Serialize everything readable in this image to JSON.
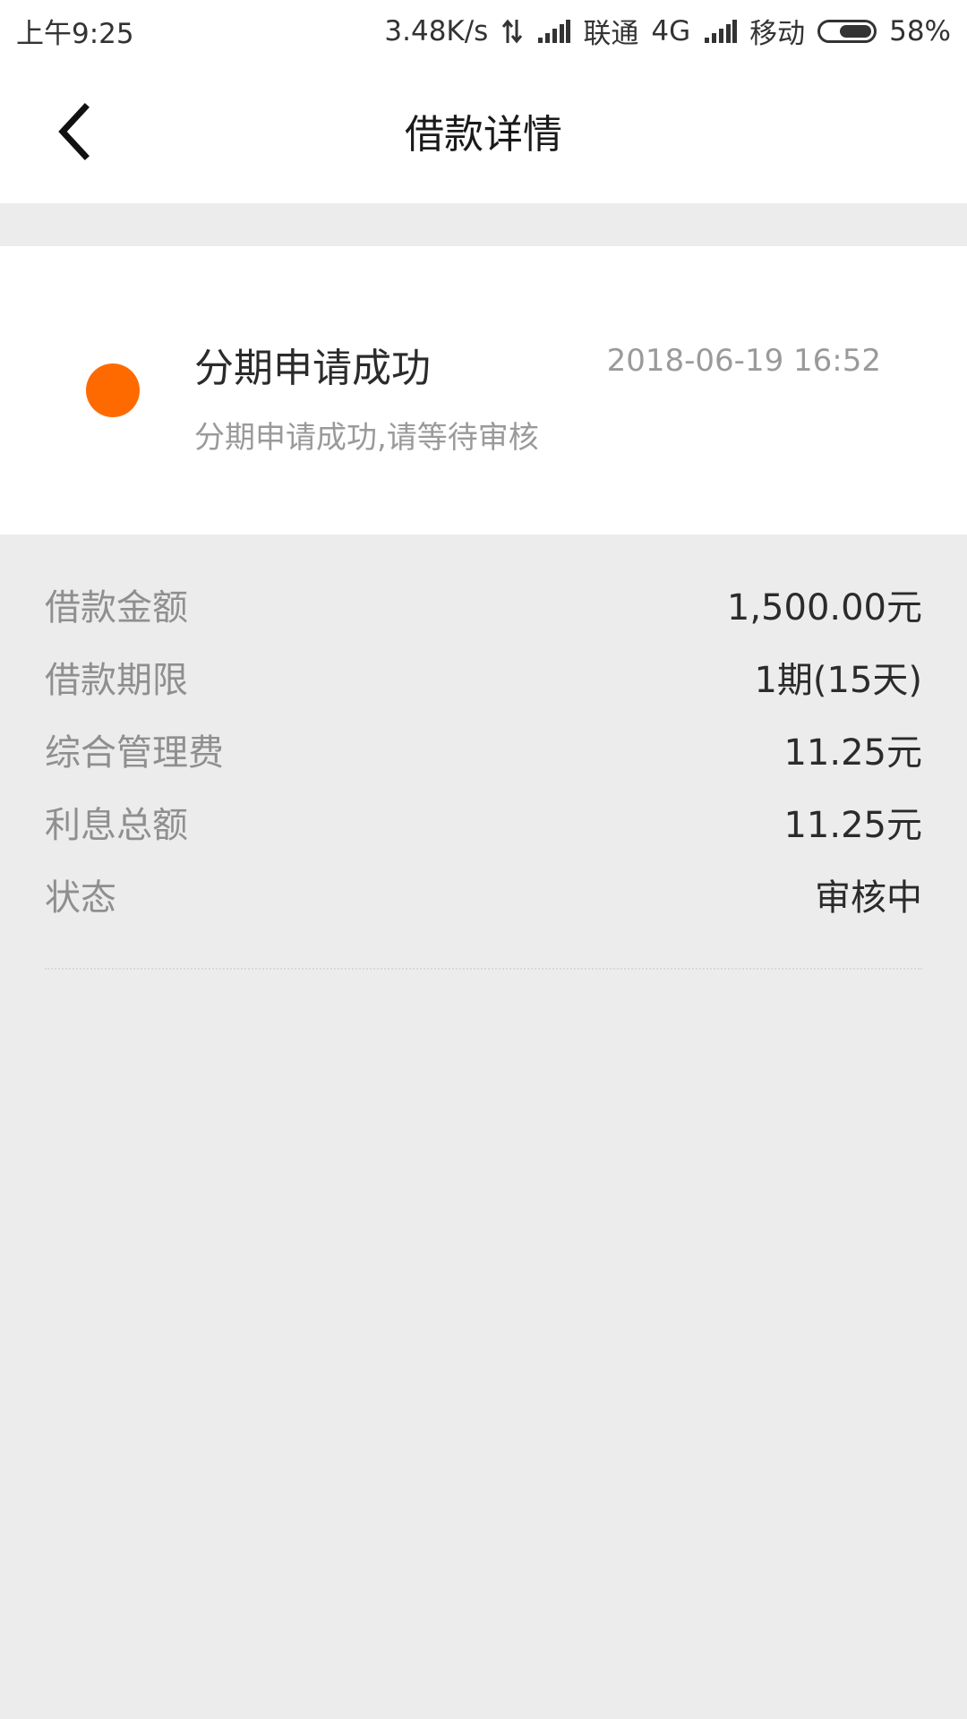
{
  "status_bar": {
    "time": "上午9:25",
    "net_speed": "3.48K/s",
    "carrier1": "联通",
    "net_type": "4G",
    "carrier2": "移动",
    "battery": "58%",
    "battery_level": 0.58,
    "icons": [
      "data-arrows-icon",
      "signal-icon",
      "signal-icon",
      "battery-icon"
    ]
  },
  "header": {
    "title": "借款详情",
    "back_icon": "chevron-left-icon"
  },
  "status_card": {
    "title": "分期申请成功",
    "time": "2018-06-19 16:52",
    "description": "分期申请成功,请等待审核",
    "dot_color": "#ff6a00"
  },
  "details": {
    "rows": [
      {
        "label": "借款金额",
        "value": "1,500.00元"
      },
      {
        "label": "借款期限",
        "value": "1期(15天)"
      },
      {
        "label": "综合管理费",
        "value": "11.25元"
      },
      {
        "label": "利息总额",
        "value": "11.25元"
      },
      {
        "label": "状态",
        "value": "审核中"
      }
    ]
  }
}
